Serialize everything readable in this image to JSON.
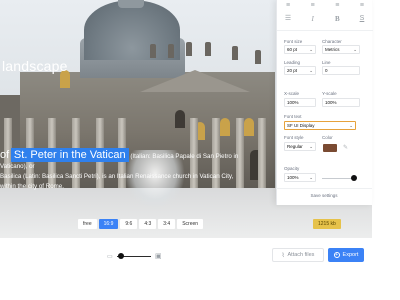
{
  "photo": {
    "title": "landscape",
    "caption_prefix": "of",
    "caption_highlight": "St. Peter in the Vatican",
    "caption_rest_line1": "(Italian: Basilica Papale di San Pietro in Vaticano), or",
    "caption_line2": "Basilica (Latin: Basilica Sancti Petri), is an Italian Renaissance church in Vatican City,",
    "caption_line3": "within the city of Rome."
  },
  "ratios": [
    "free",
    "16:9",
    "9:6",
    "4:3",
    "3:4",
    "Screen"
  ],
  "active_ratio": "16:9",
  "badges": {
    "size": "1215 kb",
    "other": ""
  },
  "panel": {
    "font_size_label": "Font size",
    "font_size_value": "60 pt",
    "character_label": "Character",
    "character_value": "Metrics",
    "leading_label": "Leading",
    "leading_value": "20 pt",
    "line_label": "Line",
    "line_value": "0",
    "xscale_label": "X-scale",
    "xscale_value": "100%",
    "yscale_label": "Y-scale",
    "yscale_value": "100%",
    "font_text_label": "Font text",
    "font_text_value": "SF UI Display",
    "font_style_label": "Font style",
    "font_style_value": "Regular",
    "color_label": "Color",
    "color_swatch": "#7a4a32",
    "opacity_label": "Opacity",
    "opacity_value": "100%",
    "opacity_fraction": 1.0,
    "save_settings": "Save settings"
  },
  "bottom": {
    "attach_label": "Attach files",
    "export_label": "Export",
    "zoom_fraction": 0.05
  },
  "colors": {
    "accent": "#3b82f6",
    "focus_border": "#e6a23c"
  }
}
